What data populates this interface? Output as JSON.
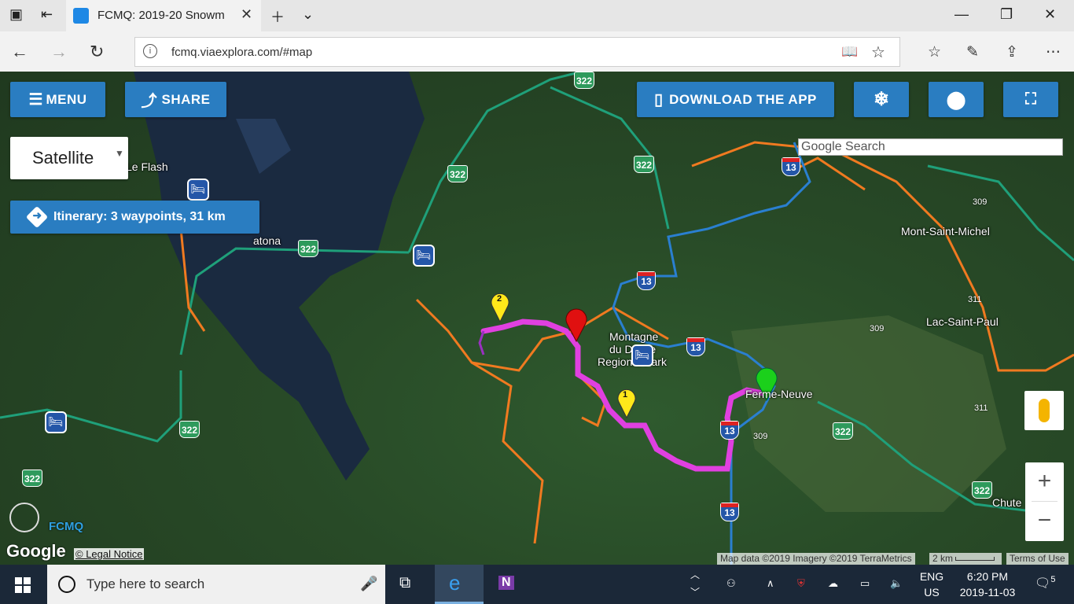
{
  "browser": {
    "tab_title": "FCMQ: 2019-20 Snowm",
    "url": "fcmq.viaexplora.com/#map"
  },
  "toolbar": {
    "menu_label": "MENU",
    "share_label": "SHARE",
    "download_label": "DOWNLOAD THE APP"
  },
  "map_type": {
    "selected": "Satellite"
  },
  "itinerary": {
    "label": "Itinerary: 3 waypoints, 31 km"
  },
  "search": {
    "placeholder": "Google Search"
  },
  "places": {
    "le_flash": "Le Flash",
    "atona": "atona",
    "mont_saint_michel": "Mont-Saint-Michel",
    "lac_saint_paul": "Lac-Saint-Paul",
    "ferme_neuve": "Ferme-Neuve",
    "chute": "Chute",
    "montagne": "Montagne",
    "du_diable": "du Diable",
    "regional_park": "Regional Park",
    "routes": {
      "r322": "322",
      "a13": "13",
      "r309": "309",
      "r311": "311"
    }
  },
  "waypoints": {
    "w1": "1",
    "w2": "2"
  },
  "attribution": {
    "map_data": "Map data ©2019 Imagery ©2019 TerraMetrics",
    "scale": "2 km",
    "terms": "Terms of Use",
    "legal": "© Legal Notice",
    "google": "Google",
    "fcmq": "FCMQ"
  },
  "taskbar": {
    "search_placeholder": "Type here to search",
    "lang_line1": "ENG",
    "lang_line2": "US",
    "time": "6:20 PM",
    "date": "2019-11-03",
    "notifications": "5"
  },
  "colors": {
    "accent": "#2a7dc1",
    "route": "#e040e0",
    "trail_orange": "#f07a20",
    "trail_green": "#1fa07a",
    "trail_blue": "#2a7fd0"
  }
}
